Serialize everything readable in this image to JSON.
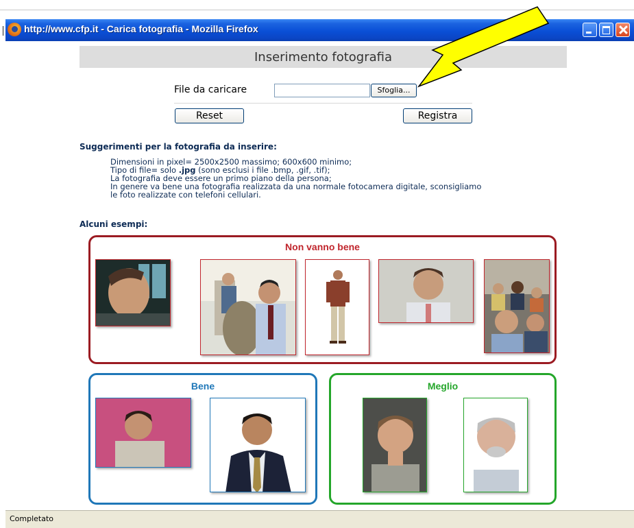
{
  "window": {
    "title": "http://www.cfp.it - Carica fotografia - Mozilla Firefox",
    "status": "Completato"
  },
  "form": {
    "heading": "Inserimento fotografia",
    "file_label": "File da caricare",
    "file_value": "",
    "browse_label": "Sfoglia...",
    "reset_label": "Reset",
    "save_label": "Registra"
  },
  "suggestions": {
    "title": "Suggerimenti per la fotografia da inserire:",
    "line1": "Dimensioni in pixel= 2500x2500 massimo; 600x600 minimo;",
    "line2_prefix": "Tipo di file= solo ",
    "line2_bold": ".jpg",
    "line2_suffix": " (sono esclusi i file .bmp, .gif, .tif);",
    "line3": "La fotografia deve essere un primo piano della persona;",
    "line4": "In genere va bene una fotografia realizzata da una normale fotocamera digitale, sconsigliamo",
    "line5": "le foto realizzate con telefoni cellulari."
  },
  "examples": {
    "title": "Alcuni esempi:",
    "bad_title": "Non vanno bene",
    "good_title": "Bene",
    "better_title": "Meglio"
  },
  "colors": {
    "bad": "#c0252c",
    "good": "#1f77b8",
    "better": "#24a62a",
    "arrow": "#ffff00",
    "titlebar": "#0a4fd6"
  }
}
